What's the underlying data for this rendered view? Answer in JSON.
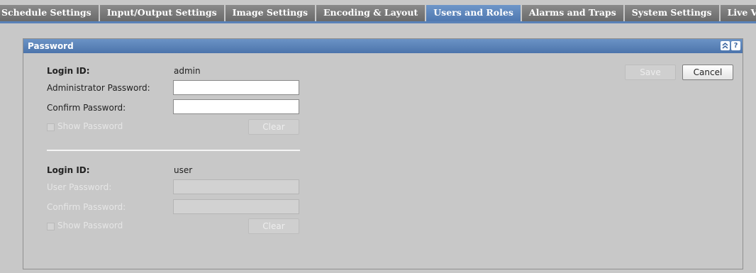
{
  "tabs": [
    {
      "label": "Schedule Settings",
      "active": false
    },
    {
      "label": "Input/Output Settings",
      "active": false
    },
    {
      "label": "Image Settings",
      "active": false
    },
    {
      "label": "Encoding & Layout",
      "active": false
    },
    {
      "label": "Users and Roles",
      "active": true
    },
    {
      "label": "Alarms and Traps",
      "active": false
    },
    {
      "label": "System Settings",
      "active": false
    },
    {
      "label": "Live View Settings",
      "active": false
    }
  ],
  "panel": {
    "title": "Password",
    "collapse_icon": "double-chevron-up-icon",
    "help_icon": "question-mark-icon",
    "help_label": "?",
    "collapse_label": "≈"
  },
  "admin": {
    "login_label": "Login ID:",
    "login_value": "admin",
    "password_label": "Administrator Password:",
    "password_value": "",
    "confirm_label": "Confirm Password:",
    "confirm_value": "",
    "show_password_label": "Show Password",
    "clear_label": "Clear"
  },
  "user": {
    "login_label": "Login ID:",
    "login_value": "user",
    "password_label": "User Password:",
    "password_value": "",
    "confirm_label": "Confirm Password:",
    "confirm_value": "",
    "show_password_label": "Show Password",
    "clear_label": "Clear"
  },
  "actions": {
    "save_label": "Save",
    "cancel_label": "Cancel"
  },
  "colors": {
    "active_tab": "#5a82b8",
    "inactive_tab": "#7a7a7a",
    "panel_header": "#5a82b8",
    "background": "#c8c8c8"
  }
}
